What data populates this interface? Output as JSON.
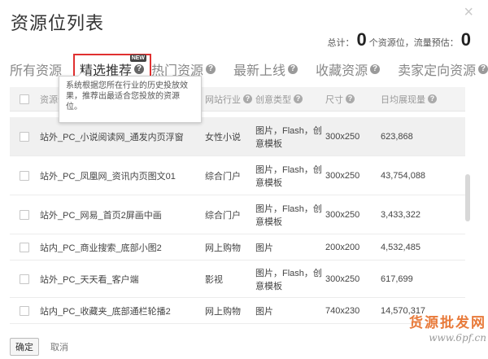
{
  "dialog": {
    "title": "资源位列表",
    "close_glyph": "×"
  },
  "summary": {
    "total_label": "总计：",
    "resource_count": "0",
    "resource_unit": "个资源位，",
    "traffic_label": "流量预估：",
    "traffic_value": "0"
  },
  "tabs": [
    {
      "label": "所有资源",
      "has_help": false
    },
    {
      "label": "精选推荐",
      "has_help": true,
      "active": true,
      "badge": "NEW"
    },
    {
      "label": "热门资源",
      "has_help": true
    },
    {
      "label": "最新上线",
      "has_help": true
    },
    {
      "label": "收藏资源",
      "has_help": true
    },
    {
      "label": "卖家定向资源",
      "has_help": true
    }
  ],
  "tooltip": {
    "text": "系统根据您所在行业的历史投放效果，推荐出最适合您投放的资源位。"
  },
  "table": {
    "headers": {
      "name": "资源位",
      "industry": "网站行业",
      "creative": "创意类型",
      "size": "尺寸",
      "impressions": "日均展现量"
    },
    "rows": [
      {
        "name": "站外_PC_小说阅读网_通发内页浮窗",
        "industry": "女性小说",
        "creative": "图片，Flash，创意模板",
        "size": "300x250",
        "impressions": "623,868",
        "highlighted": true
      },
      {
        "name": "站外_PC_凤凰网_资讯内页图文01",
        "industry": "综合门户",
        "creative": "图片，Flash，创意模板",
        "size": "300x250",
        "impressions": "43,754,088"
      },
      {
        "name": "站外_PC_网易_首页2屏画中画",
        "industry": "综合门户",
        "creative": "图片，Flash，创意模板",
        "size": "300x250",
        "impressions": "3,433,322"
      },
      {
        "name": "站内_PC_商业搜索_底部小图2",
        "industry": "网上购物",
        "creative": "图片",
        "size": "200x200",
        "impressions": "4,532,485"
      },
      {
        "name": "站外_PC_天天看_客户端",
        "industry": "影视",
        "creative": "图片，Flash，创意模板",
        "size": "300x250",
        "impressions": "617,699"
      },
      {
        "name": "站内_PC_收藏夹_底部通栏轮播2",
        "industry": "网上购物",
        "creative": "图片",
        "size": "740x230",
        "impressions": "14,570,317"
      }
    ]
  },
  "footer": {
    "ok_label": "确定",
    "cancel_label": "取消"
  },
  "watermark": {
    "line1": "货源批发网",
    "line2": "www.6pf.cn"
  },
  "colors": {
    "active_tab_border": "#e03030",
    "watermark": "#e87a3a"
  }
}
